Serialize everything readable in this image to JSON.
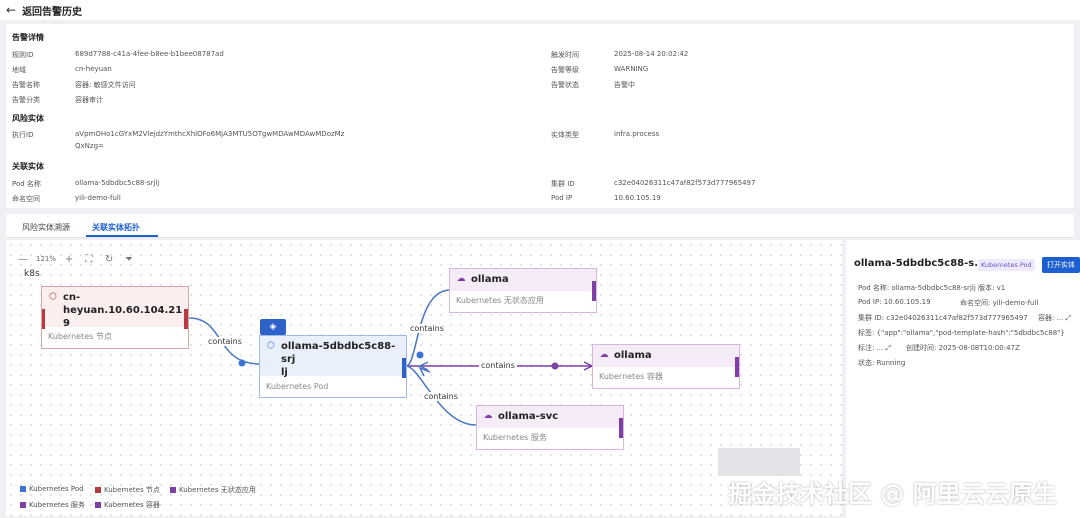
{
  "header": {
    "back_icon": "arrow-left-icon",
    "title": "返回告警历史"
  },
  "details": {
    "section_alert": "告警详情",
    "rule_id_label": "规则ID",
    "rule_id": "689d7788-c41a-4fee-b8ee-b1bee08787ad",
    "region_label": "地域",
    "region": "cn-heyuan",
    "alert_name_label": "告警名称",
    "alert_name": "容器: 敏感文件访问",
    "category_label": "告警分类",
    "category": "容器审计",
    "trigger_time_label": "触发时间",
    "trigger_time": "2025-08-14 20:02:42",
    "level_label": "告警等级",
    "level": "WARNING",
    "status_label": "告警状态",
    "status": "告警中",
    "section_risk": "风险实体",
    "exec_id_label": "执行ID",
    "exec_id_1": "aVpmOHo1cGYxM2VlejdzYmthcXhlOFo6MjA3MTU5OTgwMDAwMDAwMDozMz",
    "exec_id_2": "QxNzg=",
    "entity_type_label": "实体类型",
    "entity_type": "infra.process",
    "section_related": "关联实体",
    "pod_name_label": "Pod 名称",
    "pod_name": "ollama-5dbdbc5c88-srjlj",
    "namespace_label": "命名空间",
    "namespace": "yili-demo-full",
    "cluster_id_label": "集群 ID",
    "cluster_id": "c32e04026311c47af82f573d777965497",
    "pod_ip_label": "Pod IP",
    "pod_ip": "10.60.105.19"
  },
  "tabs": {
    "tab1": "风险实体溯源",
    "tab2": "关联实体拓扑"
  },
  "toolbar": {
    "zoom": "121%"
  },
  "graph": {
    "group_label": "k8s",
    "node_host": {
      "title": "cn-heyuan.10.60.104.219",
      "title_l1": "cn-heyuan.10.60.104.21",
      "title_l2": "9",
      "sub": "Kubernetes 节点"
    },
    "node_pod": {
      "title_l1": "ollama-5dbdbc5c88-srj",
      "title_l2": "lj",
      "sub": "Kubernetes Pod"
    },
    "node_deploy": {
      "title": "ollama",
      "sub": "Kubernetes 无状态应用"
    },
    "node_container": {
      "title": "ollama",
      "sub": "Kubernetes 容器"
    },
    "node_svc": {
      "title": "ollama-svc",
      "sub": "Kubernetes 服务"
    },
    "edge_label": "contains"
  },
  "legend": [
    {
      "label": "Kubernetes Pod",
      "color": "#3b73d6"
    },
    {
      "label": "Kubernetes 节点",
      "color": "#b8393f"
    },
    {
      "label": "Kubernetes 无状态应用",
      "color": "#7e3fa6"
    },
    {
      "label": "Kubernetes 服务",
      "color": "#7e3fa6"
    },
    {
      "label": "Kubernetes 容器",
      "color": "#7e3fa6"
    }
  ],
  "side": {
    "title": "ollama-5dbdbc5c88-s...",
    "badge": "Kubernetes Pod",
    "open_button": "打开实体",
    "row1a": "Pod 名称: ollama-5dbdbc5c88-srjlj",
    "row1b": "版本: v1",
    "row2a": "Pod IP: 10.60.105.19",
    "row2b": "命名空间: yili-demo-full",
    "row3a": "集群 ID: c32e04026311c47af82f573d777965497",
    "row3b": "容器: ... ⤢",
    "row4": "标签: {\"app\":\"ollama\",\"pod-template-hash\":\"5dbdbc5c88\"}",
    "row5a": "标注: ... ⤢",
    "row5b": "创建时间: 2025-08-08T10:00:47Z",
    "row6": "状态: Running"
  },
  "watermark": "掘金技术社区 @ 阿里云云原生"
}
